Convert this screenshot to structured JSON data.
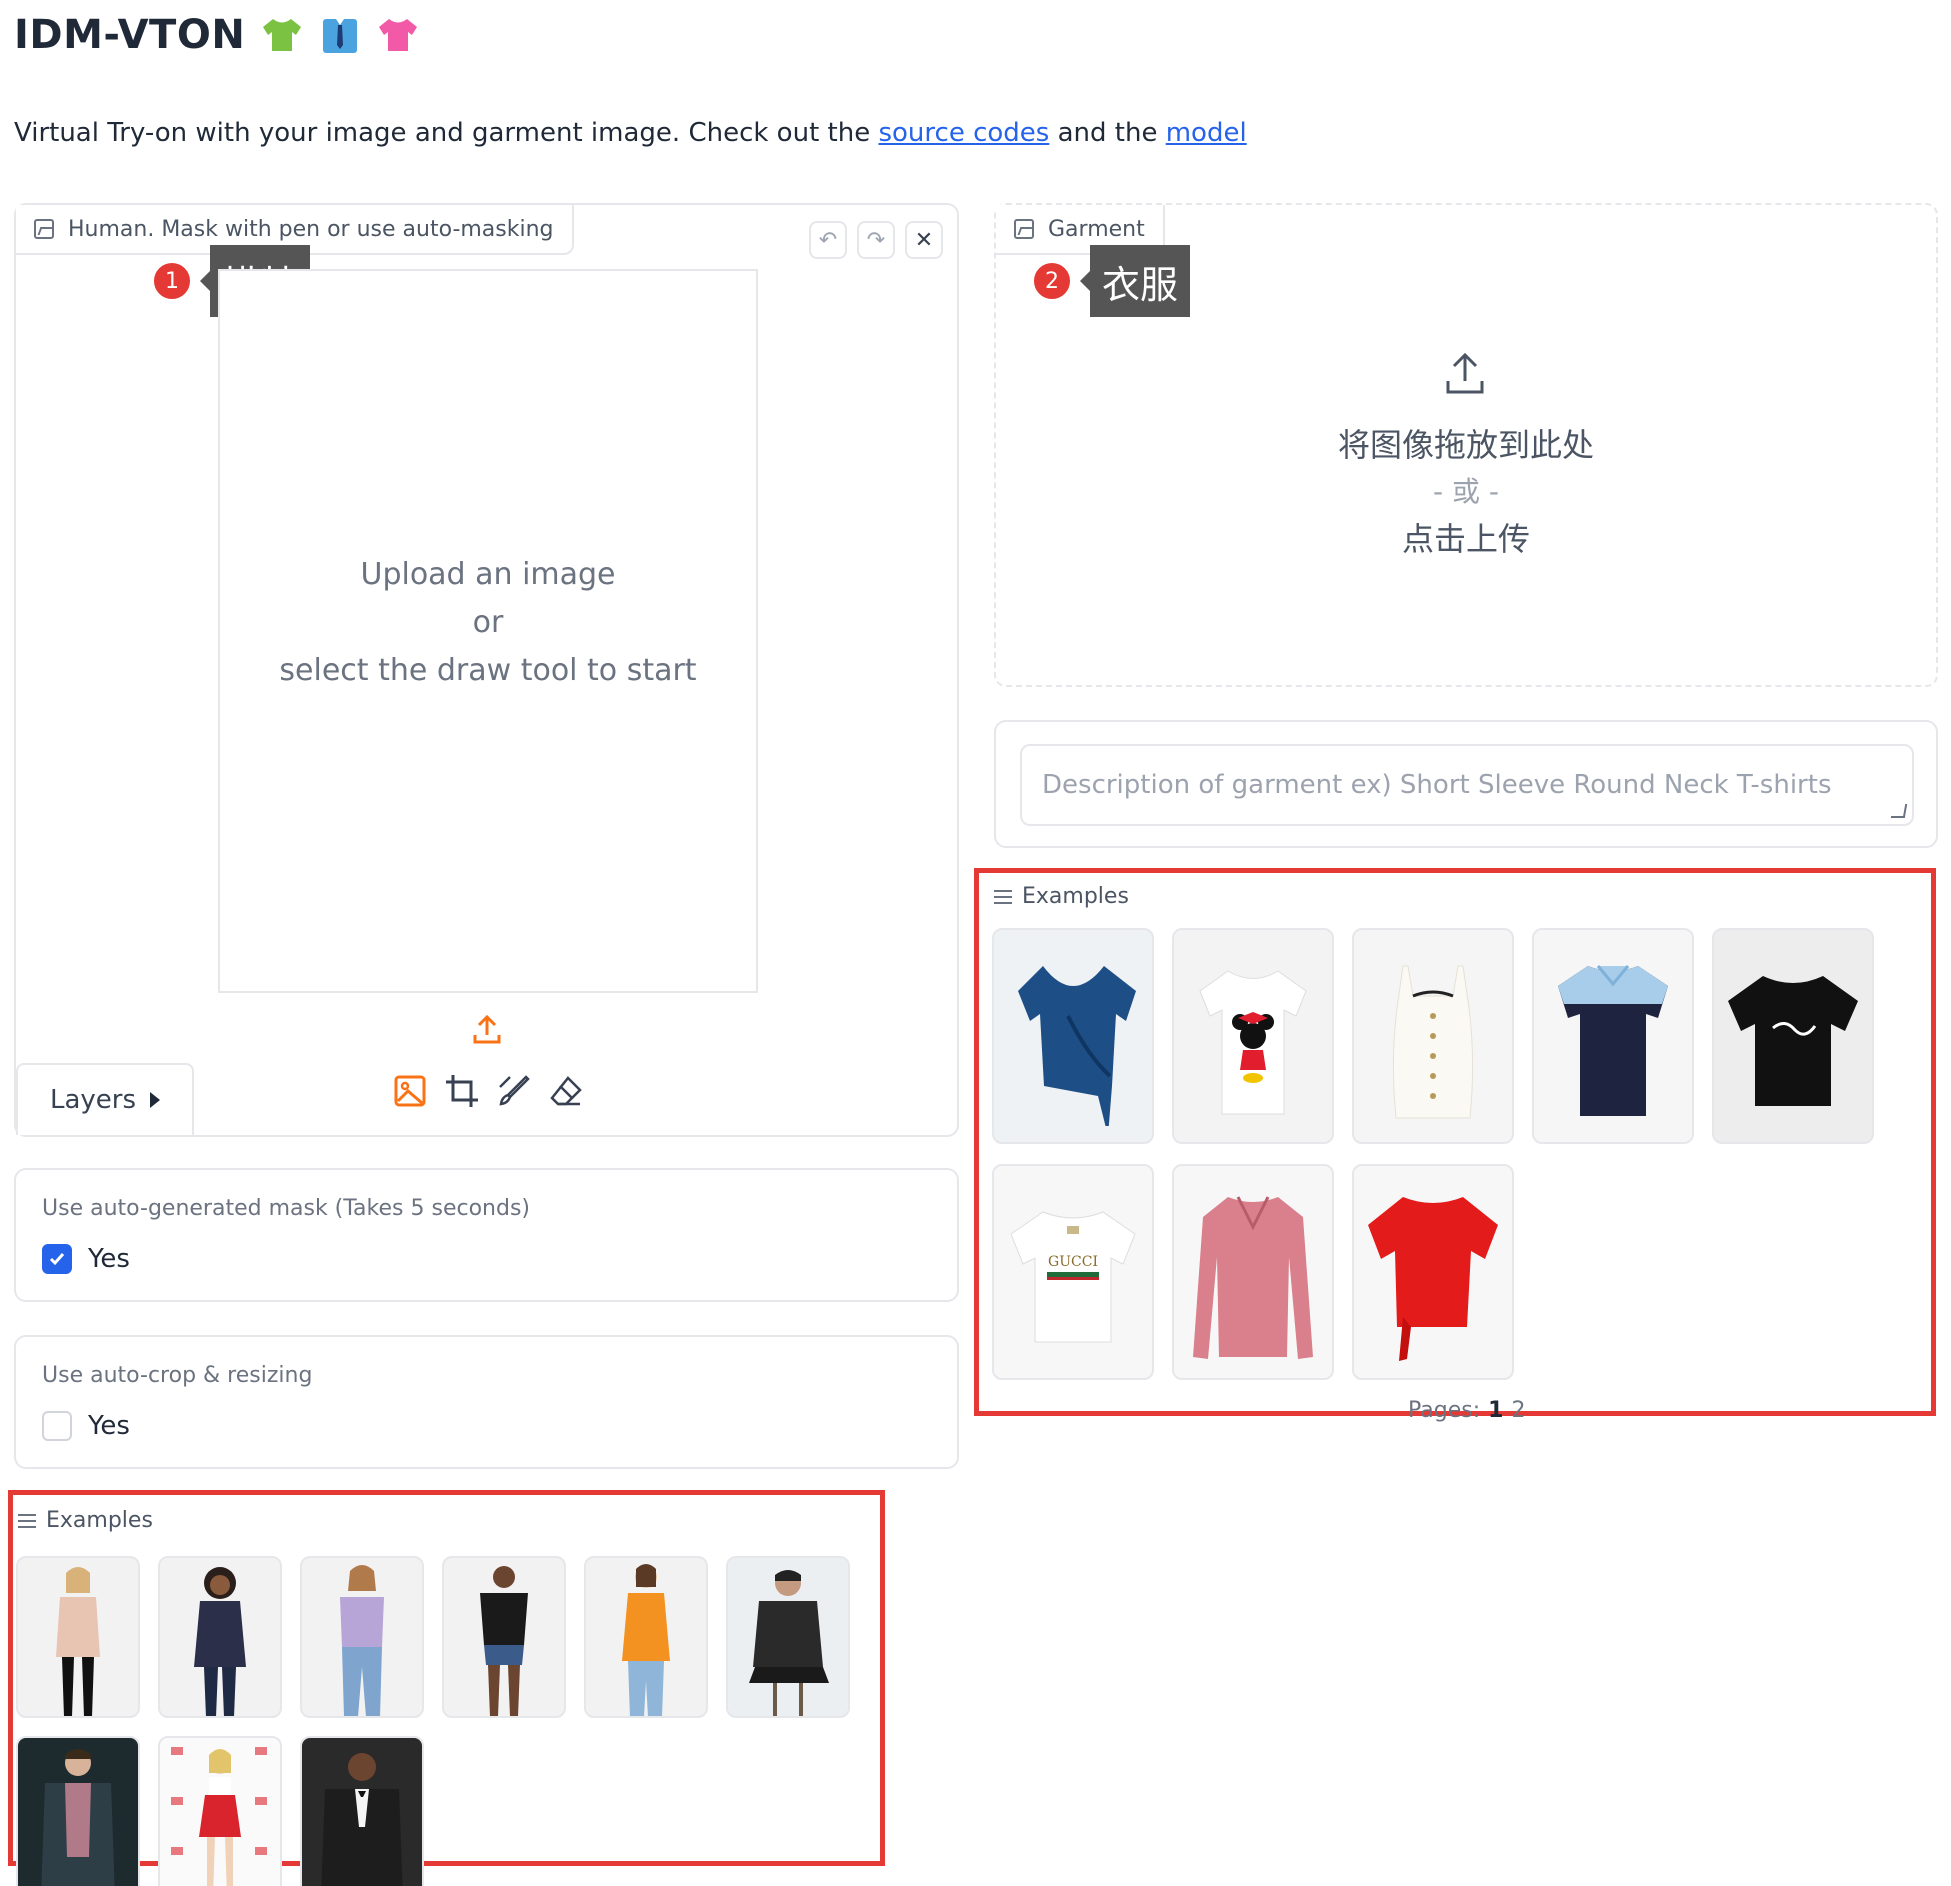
{
  "header": {
    "title": "IDM-VTON",
    "subtitle_prefix": "Virtual Try-on with your image and garment image. Check out the ",
    "link_source": "source codes",
    "subtitle_mid": " and the ",
    "link_model": "model"
  },
  "human_panel": {
    "label": "Human. Mask with pen or use auto-masking",
    "callout_number": "1",
    "callout_text": "模特",
    "upload_line1": "Upload an image",
    "upload_line2": "or",
    "upload_line3": "select the draw tool to start",
    "layers_label": "Layers",
    "undo_icon": "undo-icon",
    "redo_icon": "redo-icon",
    "close_icon": "close-icon"
  },
  "garment_panel": {
    "label": "Garment",
    "callout_number": "2",
    "callout_text": "衣服",
    "drop_text": "将图像拖放到此处",
    "or_text": "- 或 -",
    "click_text": "点击上传"
  },
  "description": {
    "placeholder": "Description of garment ex) Short Sleeve Round Neck T-shirts"
  },
  "auto_mask": {
    "label": "Use auto-generated mask (Takes 5 seconds)",
    "option": "Yes",
    "checked": true
  },
  "auto_crop": {
    "label": "Use auto-crop & resizing",
    "option": "Yes",
    "checked": false
  },
  "garment_examples": {
    "label": "Examples",
    "pages_label": "Pages:",
    "pages": [
      "1",
      "2"
    ],
    "items": [
      {
        "name": "blue-velvet-wrap-top",
        "color": "#1d4f86"
      },
      {
        "name": "minnie-mouse-tshirt",
        "color": "#f5f5f5"
      },
      {
        "name": "white-ribbed-camisole",
        "color": "#faf8f2"
      },
      {
        "name": "navy-lightblue-polo",
        "color": "#1e2340"
      },
      {
        "name": "black-stussy-tshirt",
        "color": "#111111"
      },
      {
        "name": "gucci-white-tshirt",
        "color": "#f5f5f5"
      },
      {
        "name": "pink-long-sleeve-polo",
        "color": "#d9808c"
      },
      {
        "name": "red-knot-tshirt",
        "color": "#e31b1b"
      }
    ]
  },
  "human_examples": {
    "label": "Examples",
    "items": [
      {
        "name": "woman-pink-sleeveless-blouse",
        "color": "#e8c4b2"
      },
      {
        "name": "woman-navy-long-sleeve",
        "color": "#2b2f4a"
      },
      {
        "name": "woman-lavender-vans-tee",
        "color": "#b6a5d6"
      },
      {
        "name": "woman-black-tee-shorts",
        "color": "#1a1a1a"
      },
      {
        "name": "woman-orange-top",
        "color": "#f39221"
      },
      {
        "name": "man-black-leather-jacket",
        "color": "#2a2a2a"
      },
      {
        "name": "man-dark-jacket",
        "color": "#2d3e46"
      },
      {
        "name": "woman-red-skirt-event",
        "color": "#d9232d"
      },
      {
        "name": "man-black-tuxedo",
        "color": "#1d1d1d"
      }
    ]
  },
  "colors": {
    "accent_orange": "#f97316",
    "checkbox_blue": "#2563eb",
    "highlight_red": "#e53935",
    "link_blue": "#2563eb"
  }
}
